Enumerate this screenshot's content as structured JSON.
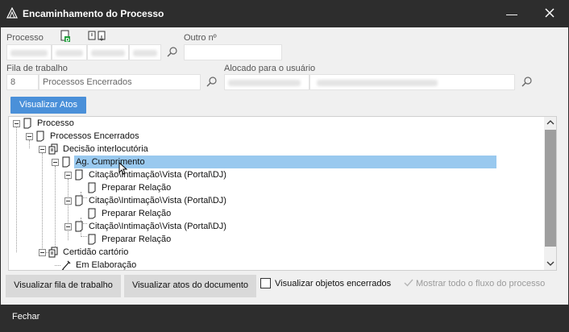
{
  "window": {
    "title": "Encaminhamento do Processo"
  },
  "form": {
    "processo_label": "Processo",
    "outro_label": "Outro nº",
    "fila_label": "Fila de trabalho",
    "fila_num": "8",
    "fila_nome": "Processos Encerrados",
    "alocado_label": "Alocado para o usuário",
    "visualizar_atos": "Visualizar Atos"
  },
  "tree": {
    "nodes": [
      "Processo",
      "Processos Encerrados",
      "Decisão interlocutória",
      "Ag. Cumprimento",
      "Citação\\Intimação\\Vista (Portal\\DJ)",
      "Preparar Relação",
      "Citação\\Intimação\\Vista (Portal\\DJ)",
      "Preparar Relação",
      "Citação\\Intimação\\Vista (Portal\\DJ)",
      "Preparar Relação",
      "Certidão cartório",
      "Em Elaboração"
    ]
  },
  "actions": {
    "visualizar_fila": "Visualizar fila de trabalho",
    "visualizar_atos_doc": "Visualizar atos do documento",
    "visualizar_objetos": "Visualizar objetos encerrados",
    "mostrar_fluxo": "Mostrar todo o fluxo do processo"
  },
  "footer": {
    "fechar": "Fechar"
  },
  "colors": {
    "accent": "#4a90d9",
    "selection": "#99c9ef",
    "titlebar": "#2d2d2d"
  }
}
